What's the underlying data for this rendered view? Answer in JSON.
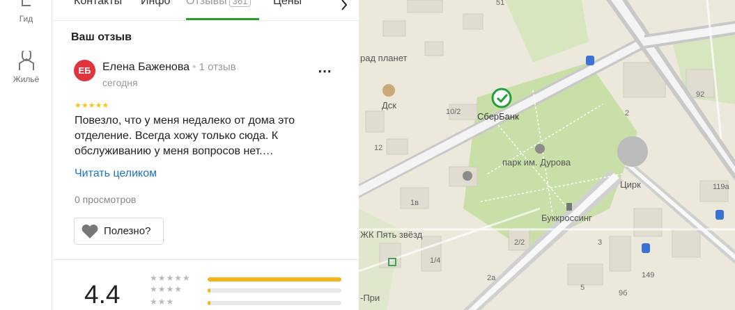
{
  "rail": {
    "items": [
      {
        "label": "Гид",
        "icon": "guide-icon"
      },
      {
        "label": "Жильё",
        "icon": "housing-icon"
      }
    ]
  },
  "tabs": {
    "items": [
      {
        "label": "Контакты"
      },
      {
        "label": "Инфо"
      },
      {
        "label": "Отзывы",
        "count": "361",
        "active": true
      },
      {
        "label": "Цены"
      }
    ]
  },
  "review": {
    "section_title": "Ваш отзыв",
    "avatar_initials": "ЕБ",
    "author": "Елена Баженова",
    "author_review_count": "1 отзыв",
    "date": "сегодня",
    "stars": 5,
    "text": "Повезло, что у меня недалеко от дома это отделение. Всегда хожу только сюда. К обслуживанию у меня вопросов нет.…",
    "read_more": "Читать целиком",
    "views": "0 просмотров",
    "useful_label": "Полезно?"
  },
  "rating": {
    "value": "4.4",
    "distribution": [
      {
        "stars": 5,
        "fraction": 1.0
      },
      {
        "stars": 4,
        "fraction": 0.02
      },
      {
        "stars": 3,
        "fraction": 0.02
      }
    ]
  },
  "map": {
    "labels": [
      {
        "text": "СберБанк",
        "kind": "poi"
      },
      {
        "text": "парк им. Дурова",
        "kind": "poi"
      },
      {
        "text": "Цирк",
        "kind": "poi"
      },
      {
        "text": "Дск",
        "kind": "poi"
      },
      {
        "text": "Буккроссинг",
        "kind": "poi"
      },
      {
        "text": "рад планет",
        "kind": "poi"
      },
      {
        "text": "ЖК Пять звёзд",
        "kind": "poi"
      },
      {
        "text": "-При",
        "kind": "poi"
      }
    ],
    "house_numbers": [
      "51",
      "92",
      "10/2",
      "12",
      "2",
      "1в",
      "1/4",
      "2/2",
      "3",
      "2а",
      "149",
      "9б",
      "119а",
      "5"
    ],
    "colors": {
      "road": "#c8c8c8",
      "park": "#c9dfa8",
      "ground": "#ece9dc",
      "building": "#e0ddd0"
    }
  }
}
